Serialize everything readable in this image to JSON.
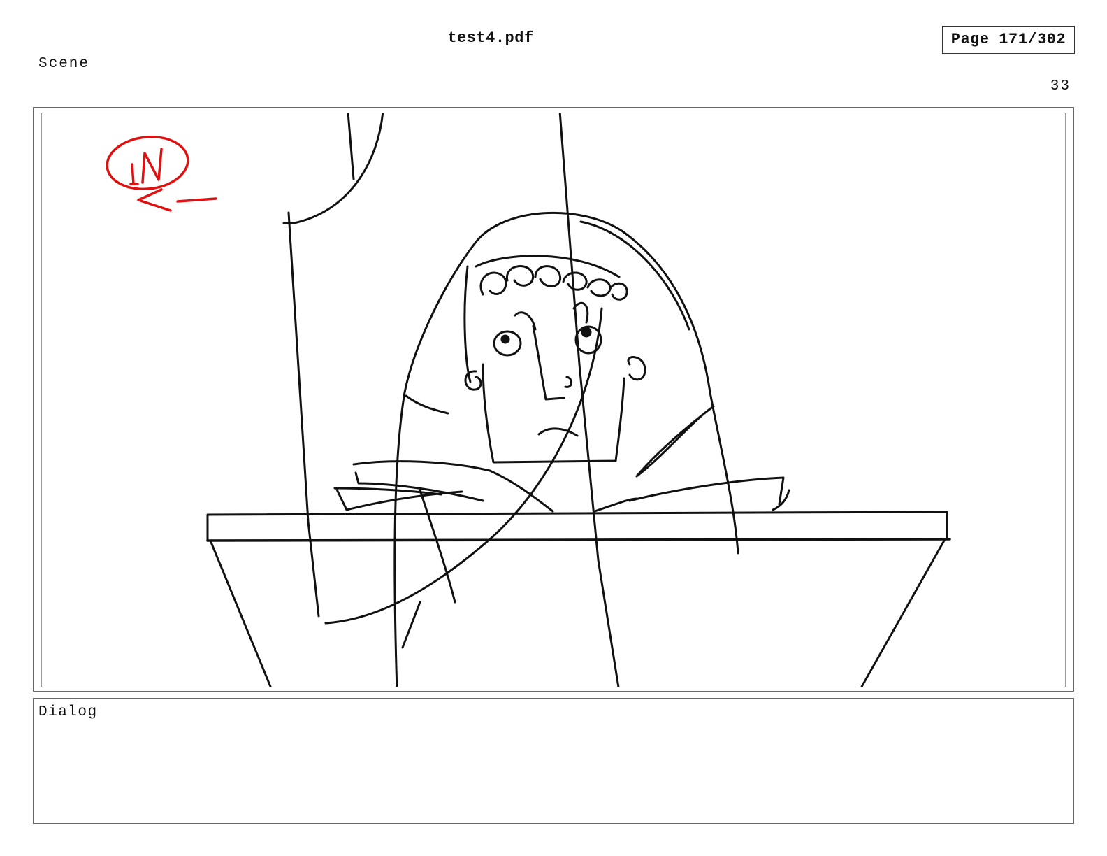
{
  "header": {
    "file_name": "test4.pdf",
    "page_indicator": "Page 171/302"
  },
  "scene": {
    "label": "Scene",
    "panel_number": "33"
  },
  "panel": {
    "annotation_text": "IN",
    "annotation_color": "#e01010",
    "sketch_color": "#111111"
  },
  "dialog": {
    "label": "Dialog",
    "text": ""
  }
}
